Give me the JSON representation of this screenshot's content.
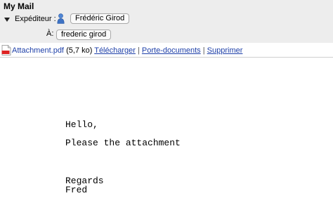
{
  "window": {
    "title": "My Mail"
  },
  "header": {
    "from_label": "Expéditeur :",
    "from_value": "Frédéric Girod",
    "to_label": "À:",
    "to_value": "frederic girod"
  },
  "attachment": {
    "icon": "pdf-icon",
    "filename": "Attachment.pdf",
    "size": "(5,7 ko)",
    "actions": [
      "Télécharger",
      "Porte-documents",
      "Supprimer"
    ],
    "separator": "|"
  },
  "message": {
    "lines": [
      "Hello,",
      "Please the attachment",
      "Regards",
      "Fred"
    ]
  }
}
